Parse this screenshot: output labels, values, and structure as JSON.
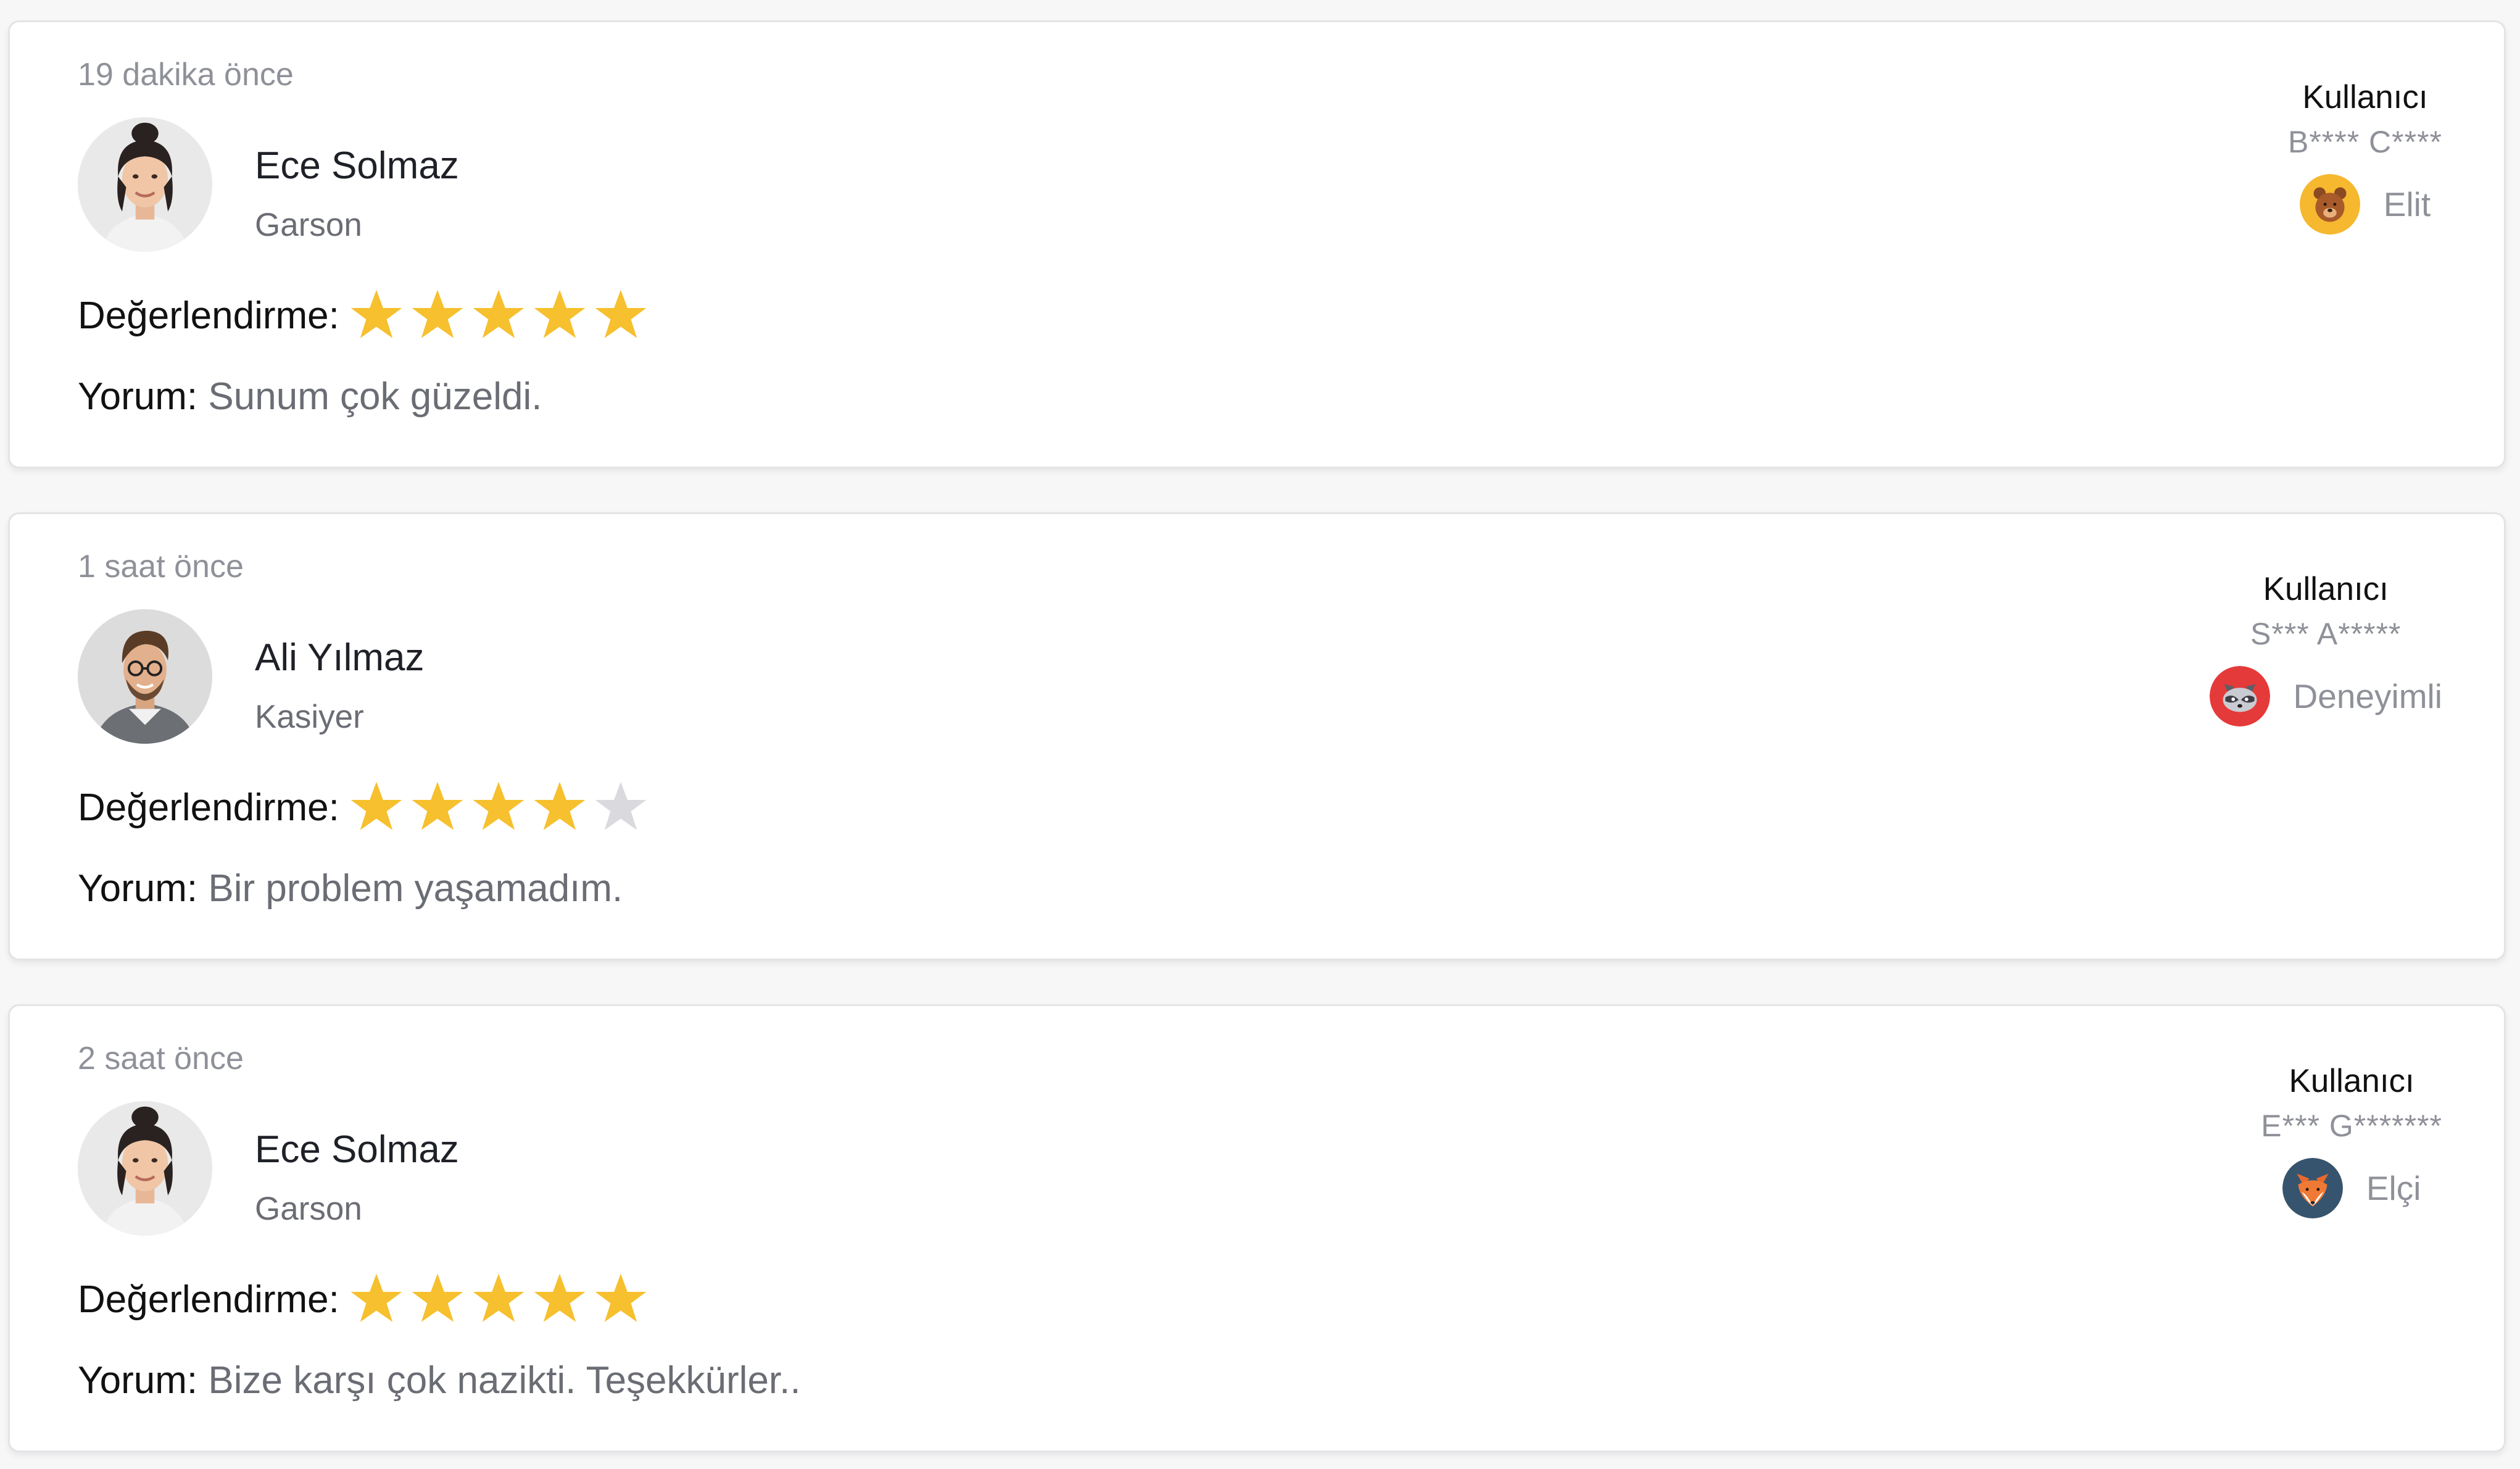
{
  "reviews": [
    {
      "time": "19 dakika önce",
      "employee": {
        "name": "Ece Solmaz",
        "role": "Garson",
        "avatar": "woman-avatar"
      },
      "rating_label": "Değerlendirme:",
      "rating": 5,
      "rating_max": 5,
      "comment_label": "Yorum:",
      "comment": "Sunum çok güzeldi.",
      "user_title": "Kullanıcı",
      "user_masked": "B**** C****",
      "level": "Elit",
      "level_icon": "bear-icon",
      "level_color": "#f5b82e"
    },
    {
      "time": "1 saat önce",
      "employee": {
        "name": "Ali Yılmaz",
        "role": "Kasiyer",
        "avatar": "man-avatar"
      },
      "rating_label": "Değerlendirme:",
      "rating": 4,
      "rating_max": 5,
      "comment_label": "Yorum:",
      "comment": "Bir problem yaşamadım.",
      "user_title": "Kullanıcı",
      "user_masked": "S*** A*****",
      "level": "Deneyimli",
      "level_icon": "raccoon-icon",
      "level_color": "#e53a3a"
    },
    {
      "time": "2 saat önce",
      "employee": {
        "name": "Ece Solmaz",
        "role": "Garson",
        "avatar": "woman-avatar"
      },
      "rating_label": "Değerlendirme:",
      "rating": 5,
      "rating_max": 5,
      "comment_label": "Yorum:",
      "comment": "Bize karşı çok nazikti. Teşekkürler..",
      "user_title": "Kullanıcı",
      "user_masked": "E*** G*******",
      "level": "Elçi",
      "level_icon": "fox-icon",
      "level_color": "#37546e"
    }
  ],
  "colors": {
    "star_filled": "#f6c02e",
    "star_empty": "#d9d9de",
    "muted_text": "#8f9199",
    "secondary_text": "#6b6d75"
  }
}
